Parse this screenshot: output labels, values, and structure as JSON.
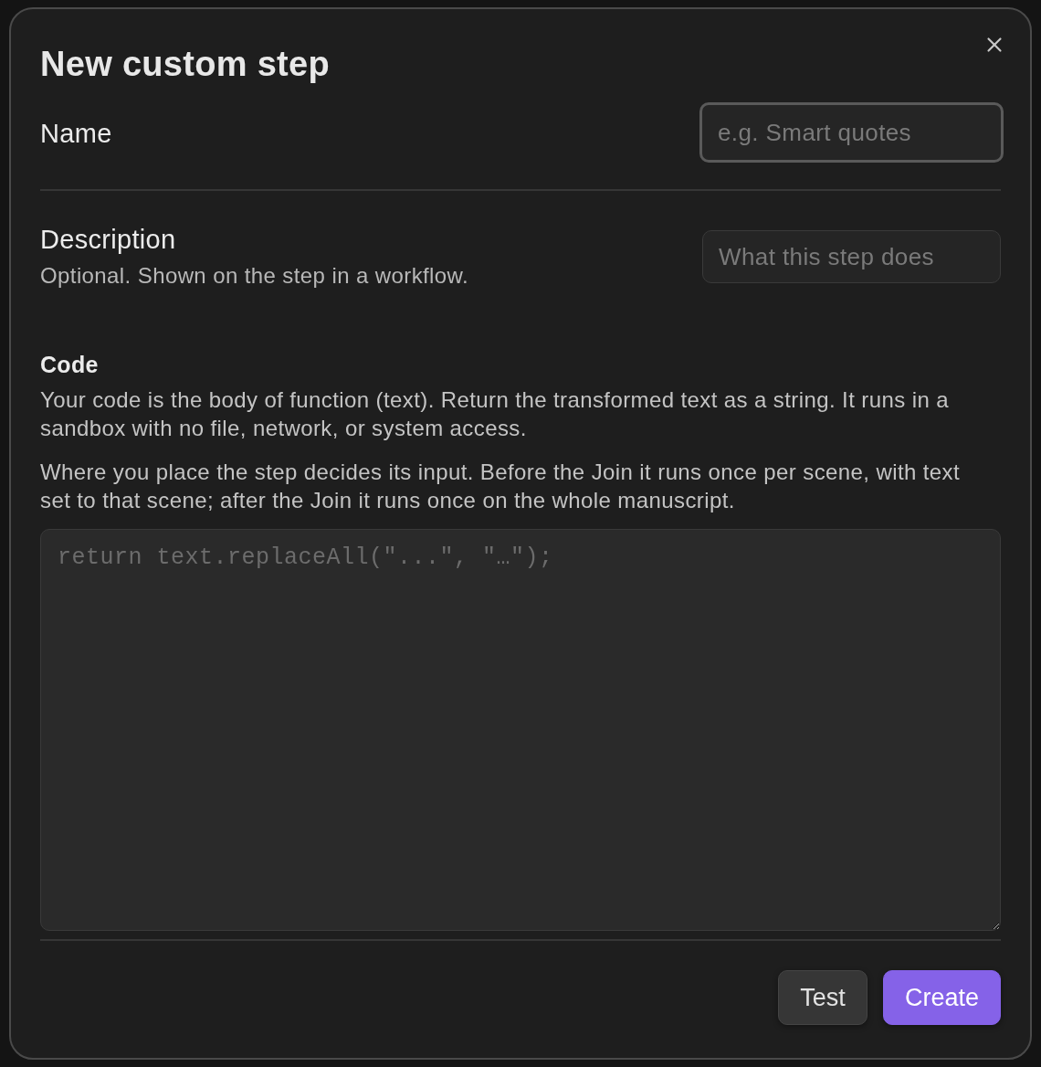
{
  "dialog": {
    "title": "New custom step"
  },
  "fields": [
    {
      "label": "Name",
      "placeholder": "e.g. Smart quotes",
      "focused": true
    },
    {
      "label": "Description",
      "hint": "Optional. Shown on the step in a workflow.",
      "placeholder": "What this step does",
      "focused": false
    }
  ],
  "code": {
    "label": "Code",
    "paragraphs": [
      "Your code is the body of function (text). Return the transformed text as a string. It runs in a sandbox with no file, network, or system access.",
      "Where you place the step decides its input. Before the Join it runs once per scene, with text set to that scene; after the Join it runs once on the whole manuscript."
    ],
    "placeholder": "return text.replaceAll(\"...\", \"…\");"
  },
  "buttons": [
    {
      "label": "Test",
      "kind": "secondary"
    },
    {
      "label": "Create",
      "kind": "primary"
    }
  ]
}
